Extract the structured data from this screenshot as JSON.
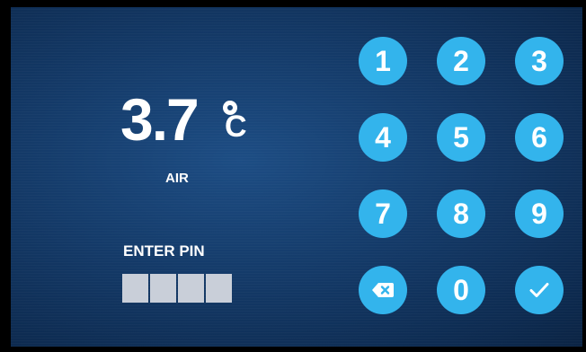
{
  "temperature": {
    "value": "3.7",
    "unit": "C",
    "label": "AIR"
  },
  "pin": {
    "label": "ENTER PIN",
    "boxes": 4
  },
  "keypad": {
    "keys": [
      "1",
      "2",
      "3",
      "4",
      "5",
      "6",
      "7",
      "8",
      "9",
      "0"
    ],
    "backspace_icon": "backspace-icon",
    "confirm_icon": "check-icon"
  },
  "colors": {
    "key": "#33b4ec",
    "background": "#143a68",
    "pin_box": "#c9cfd9"
  }
}
